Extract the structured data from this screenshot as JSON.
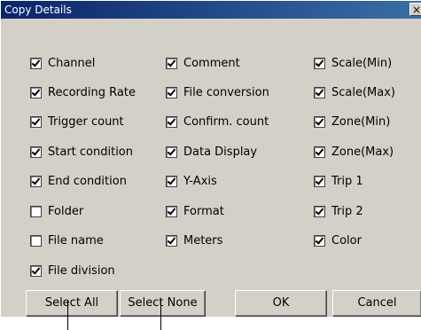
{
  "window": {
    "title": "Copy Details",
    "close_glyph": "×"
  },
  "checkboxes": [
    {
      "label": "Channel",
      "checked": true
    },
    {
      "label": "Recording Rate",
      "checked": true
    },
    {
      "label": "Trigger count",
      "checked": true
    },
    {
      "label": "Start condition",
      "checked": true
    },
    {
      "label": "End condition",
      "checked": true
    },
    {
      "label": "Folder",
      "checked": false
    },
    {
      "label": "File name",
      "checked": false
    },
    {
      "label": "File division",
      "checked": true
    },
    {
      "label": "Comment",
      "checked": true
    },
    {
      "label": "File conversion",
      "checked": true
    },
    {
      "label": "Confirm. count",
      "checked": true
    },
    {
      "label": "Data Display",
      "checked": true
    },
    {
      "label": "Y-Axis",
      "checked": true
    },
    {
      "label": "Format",
      "checked": true
    },
    {
      "label": "Meters",
      "checked": true
    },
    {
      "label": "Scale(Min)",
      "checked": true
    },
    {
      "label": "Scale(Max)",
      "checked": true
    },
    {
      "label": "Zone(Min)",
      "checked": true
    },
    {
      "label": "Zone(Max)",
      "checked": true
    },
    {
      "label": "Trip 1",
      "checked": true
    },
    {
      "label": "Trip 2",
      "checked": true
    },
    {
      "label": "Color",
      "checked": true
    }
  ],
  "buttons": {
    "select_all": "Select All",
    "select_none": "Select None",
    "ok": "OK",
    "cancel": "Cancel"
  }
}
